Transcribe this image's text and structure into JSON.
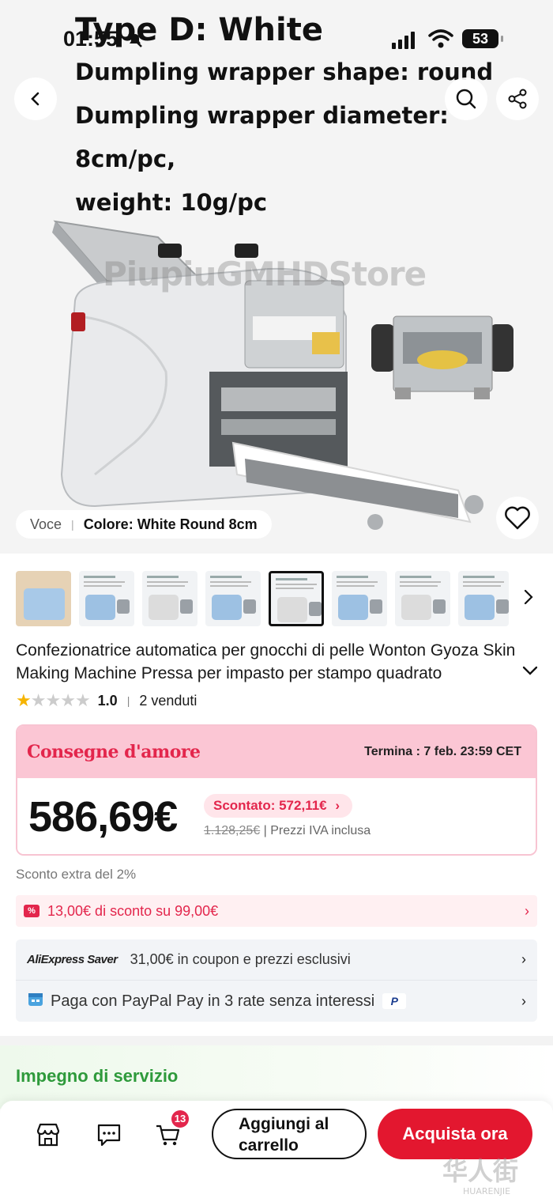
{
  "hero": {
    "line1": "Type D: White",
    "line2": "Dumpling wrapper shape: round",
    "line3": "Dumpling wrapper diameter: 8cm/pc,",
    "line4": "weight: 10g/pc",
    "watermark": "PiupiuGMHDStore"
  },
  "status_bar": {
    "time": "01:55",
    "battery": "53"
  },
  "variant": {
    "label": "Voce",
    "value": "Colore: White Round 8cm"
  },
  "thumbnails": {
    "count": 8,
    "selected_index": 4
  },
  "product": {
    "title": "Confezionatrice automatica per gnocchi di pelle Wonton Gyoza Skin Making Machine Pressa per impasto per stampo quadrato",
    "rating": 1.0,
    "rating_text": "1.0",
    "sold": "2 venduti"
  },
  "promo": {
    "name": "Consegne d'amore",
    "ends": "Termina : 7 feb. 23:59 CET",
    "price": "586,69€",
    "discounted": "Scontato: 572,11€",
    "original_price": "1.128,25€",
    "vat_note": "Prezzi IVA inclusa"
  },
  "extra_discount": "Sconto extra del 2%",
  "coupon": {
    "text": "13,00€ di sconto su 99,00€"
  },
  "saver": {
    "logo": "AliExpress Saver",
    "coupon_text": "31,00€ in coupon e prezzi esclusivi",
    "paypal_text": "Paga con PayPal Pay in 3 rate senza interessi"
  },
  "service": {
    "label": "Impegno di servizio"
  },
  "bottom_bar": {
    "cart_count": "13",
    "add_to_cart": "Aggiungi al carrello",
    "buy_now": "Acquista ora"
  },
  "colors": {
    "accent": "#e3172f",
    "promo_pink": "#fbc6d4",
    "service_green": "#2e9a3b"
  }
}
